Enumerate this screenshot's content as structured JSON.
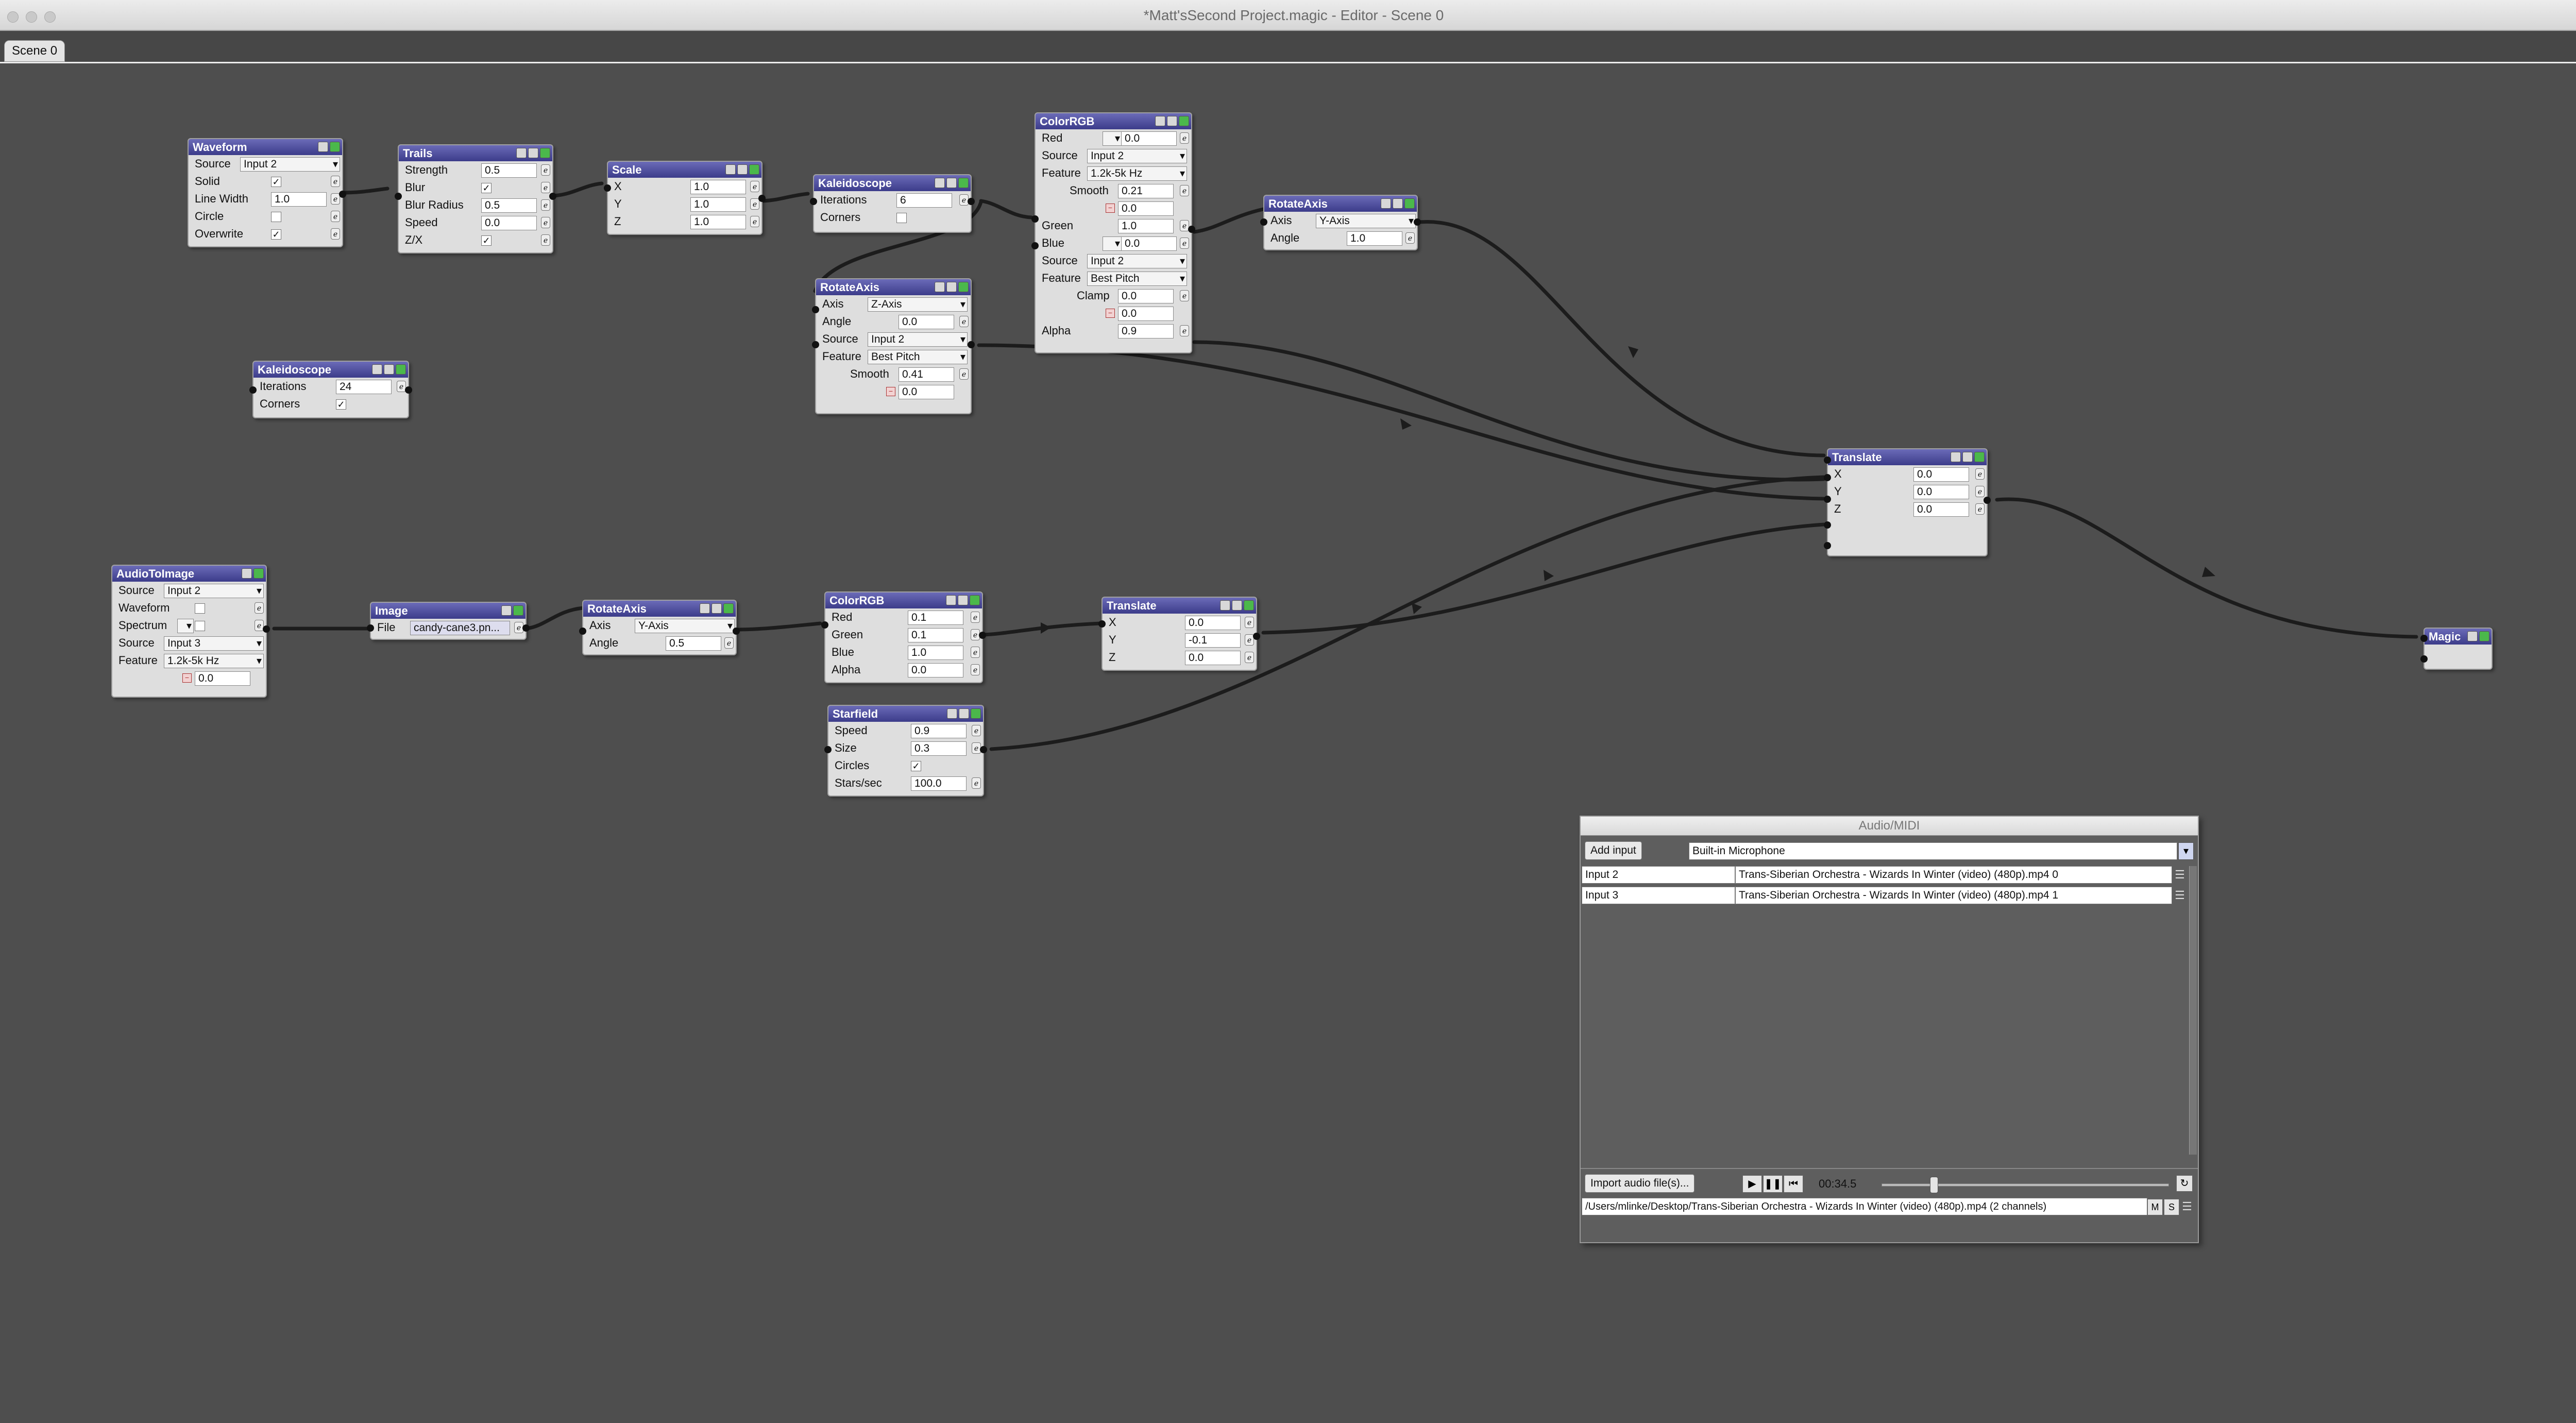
{
  "window": {
    "title": "*Matt'sSecond Project.magic - Editor - Scene 0"
  },
  "tabs": [
    {
      "label": "Scene 0"
    }
  ],
  "nodes": {
    "waveform": {
      "title": "Waveform",
      "source_label": "Source",
      "source": "Input 2",
      "solid_label": "Solid",
      "solid": "✓",
      "linewidth_label": "Line Width",
      "linewidth": "1.0",
      "circle_label": "Circle",
      "overwrite_label": "Overwrite",
      "overwrite": "✓"
    },
    "trails": {
      "title": "Trails",
      "strength_label": "Strength",
      "strength": "0.5",
      "blur_label": "Blur",
      "blur": "✓",
      "blurradius_label": "Blur Radius",
      "blurradius": "0.5",
      "speed_label": "Speed",
      "speed": "0.0",
      "zx_label": "Z/X",
      "zx": "✓"
    },
    "scale": {
      "title": "Scale",
      "x_label": "X",
      "x": "1.0",
      "y_label": "Y",
      "y": "1.0",
      "z_label": "Z",
      "z": "1.0"
    },
    "kaleido1": {
      "title": "Kaleidoscope",
      "iter_label": "Iterations",
      "iter": "6",
      "corners_label": "Corners"
    },
    "rotate1": {
      "title": "RotateAxis",
      "axis_label": "Axis",
      "axis": "Z-Axis",
      "angle_label": "Angle",
      "angle": "0.0",
      "source_label": "Source",
      "source": "Input 2",
      "feature_label": "Feature",
      "feature": "Best Pitch",
      "smooth_label": "Smooth",
      "smooth": "0.41",
      "min": "0.0"
    },
    "colorrgb1": {
      "title": "ColorRGB",
      "red_label": "Red",
      "red": "0.0",
      "source_label": "Source",
      "source": "Input 2",
      "feature_label": "Feature",
      "feature": "1.2k-5k Hz",
      "smooth_label": "Smooth",
      "smooth": "0.21",
      "min1": "0.0",
      "green_label": "Green",
      "green": "1.0",
      "blue_label": "Blue",
      "blue": "0.0",
      "source2_label": "Source",
      "source2": "Input 2",
      "feature2_label": "Feature",
      "feature2": "Best Pitch",
      "clamp_label": "Clamp",
      "clamp": "0.0",
      "min2": "0.0",
      "alpha_label": "Alpha",
      "alpha": "0.9"
    },
    "rotate2": {
      "title": "RotateAxis",
      "axis_label": "Axis",
      "axis": "Y-Axis",
      "angle_label": "Angle",
      "angle": "1.0"
    },
    "kaleido2": {
      "title": "Kaleidoscope",
      "iter_label": "Iterations",
      "iter": "24",
      "corners_label": "Corners",
      "corners": "✓"
    },
    "translate1": {
      "title": "Translate",
      "x_label": "X",
      "x": "0.0",
      "y_label": "Y",
      "y": "0.0",
      "z_label": "Z",
      "z": "0.0"
    },
    "audioimg": {
      "title": "AudioToImage",
      "source_label": "Source",
      "source": "Input 2",
      "waveform_label": "Waveform",
      "spectrum_label": "Spectrum",
      "source2_label": "Source",
      "source2": "Input 3",
      "feature_label": "Feature",
      "feature": "1.2k-5k Hz",
      "min": "0.0"
    },
    "image": {
      "title": "Image",
      "file_label": "File",
      "file": "candy-cane3.pn..."
    },
    "rotate3": {
      "title": "RotateAxis",
      "axis_label": "Axis",
      "axis": "Y-Axis",
      "angle_label": "Angle",
      "angle": "0.5"
    },
    "colorrgb2": {
      "title": "ColorRGB",
      "red_label": "Red",
      "red": "0.1",
      "green_label": "Green",
      "green": "0.1",
      "blue_label": "Blue",
      "blue": "1.0",
      "alpha_label": "Alpha",
      "alpha": "0.0"
    },
    "translate2": {
      "title": "Translate",
      "x_label": "X",
      "x": "0.0",
      "y_label": "Y",
      "y": "-0.1",
      "z_label": "Z",
      "z": "0.0"
    },
    "starfield": {
      "title": "Starfield",
      "speed_label": "Speed",
      "speed": "0.9",
      "size_label": "Size",
      "size": "0.3",
      "circles_label": "Circles",
      "circles": "✓",
      "stars_label": "Stars/sec",
      "stars": "100.0"
    },
    "magic": {
      "title": "Magic"
    }
  },
  "audio_panel": {
    "title": "Audio/MIDI",
    "add_input": "Add input",
    "device": "Built-in Microphone",
    "inputs": [
      {
        "name": "Input 2",
        "file": "Trans-Siberian Orchestra - Wizards In Winter (video) (480p).mp4 0"
      },
      {
        "name": "Input 3",
        "file": "Trans-Siberian Orchestra - Wizards In Winter (video) (480p).mp4 1"
      }
    ],
    "import_label": "Import audio file(s)...",
    "time": "00:34.5",
    "progress": 0.18,
    "path": "/Users/mlinke/Desktop/Trans-Siberian Orchestra - Wizards In Winter (video) (480p).mp4 (2 channels)",
    "m_label": "M",
    "s_label": "S"
  }
}
